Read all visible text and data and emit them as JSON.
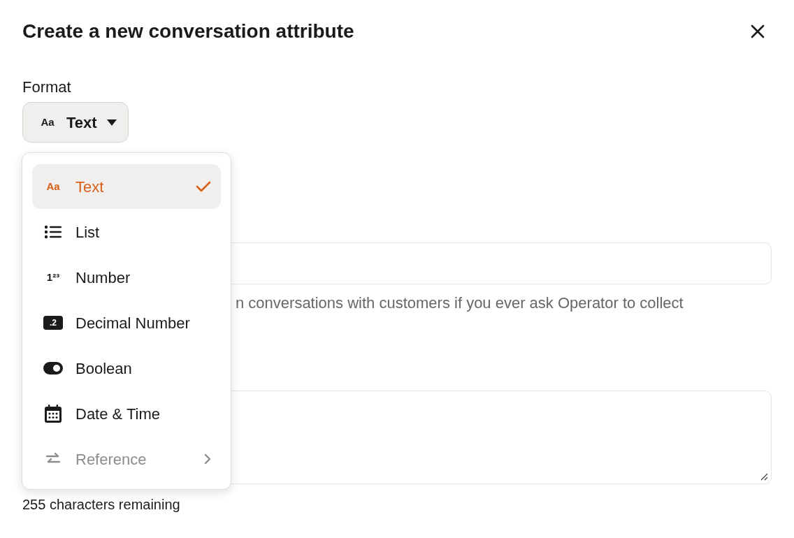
{
  "dialog": {
    "title": "Create a new conversation attribute"
  },
  "format": {
    "label": "Format",
    "button": {
      "glyph": "Aa",
      "label": "Text"
    }
  },
  "menu": {
    "items": [
      {
        "kind": "text",
        "glyph": "Aa",
        "label": "Text",
        "selected": true,
        "disabled": false,
        "submenu": false
      },
      {
        "kind": "list",
        "label": "List",
        "selected": false,
        "disabled": false,
        "submenu": false
      },
      {
        "kind": "number",
        "glyph": "1²³",
        "label": "Number",
        "selected": false,
        "disabled": false,
        "submenu": false
      },
      {
        "kind": "decimal",
        "glyph": ".2",
        "label": "Decimal Number",
        "selected": false,
        "disabled": false,
        "submenu": false
      },
      {
        "kind": "boolean",
        "label": "Boolean",
        "selected": false,
        "disabled": false,
        "submenu": false
      },
      {
        "kind": "datetime",
        "label": "Date & Time",
        "selected": false,
        "disabled": false,
        "submenu": false
      },
      {
        "kind": "reference",
        "label": "Reference",
        "selected": false,
        "disabled": true,
        "submenu": true
      }
    ]
  },
  "name_help": "n conversations with customers if you ever ask Operator to collect",
  "description": {
    "counter": "255 characters remaining"
  }
}
